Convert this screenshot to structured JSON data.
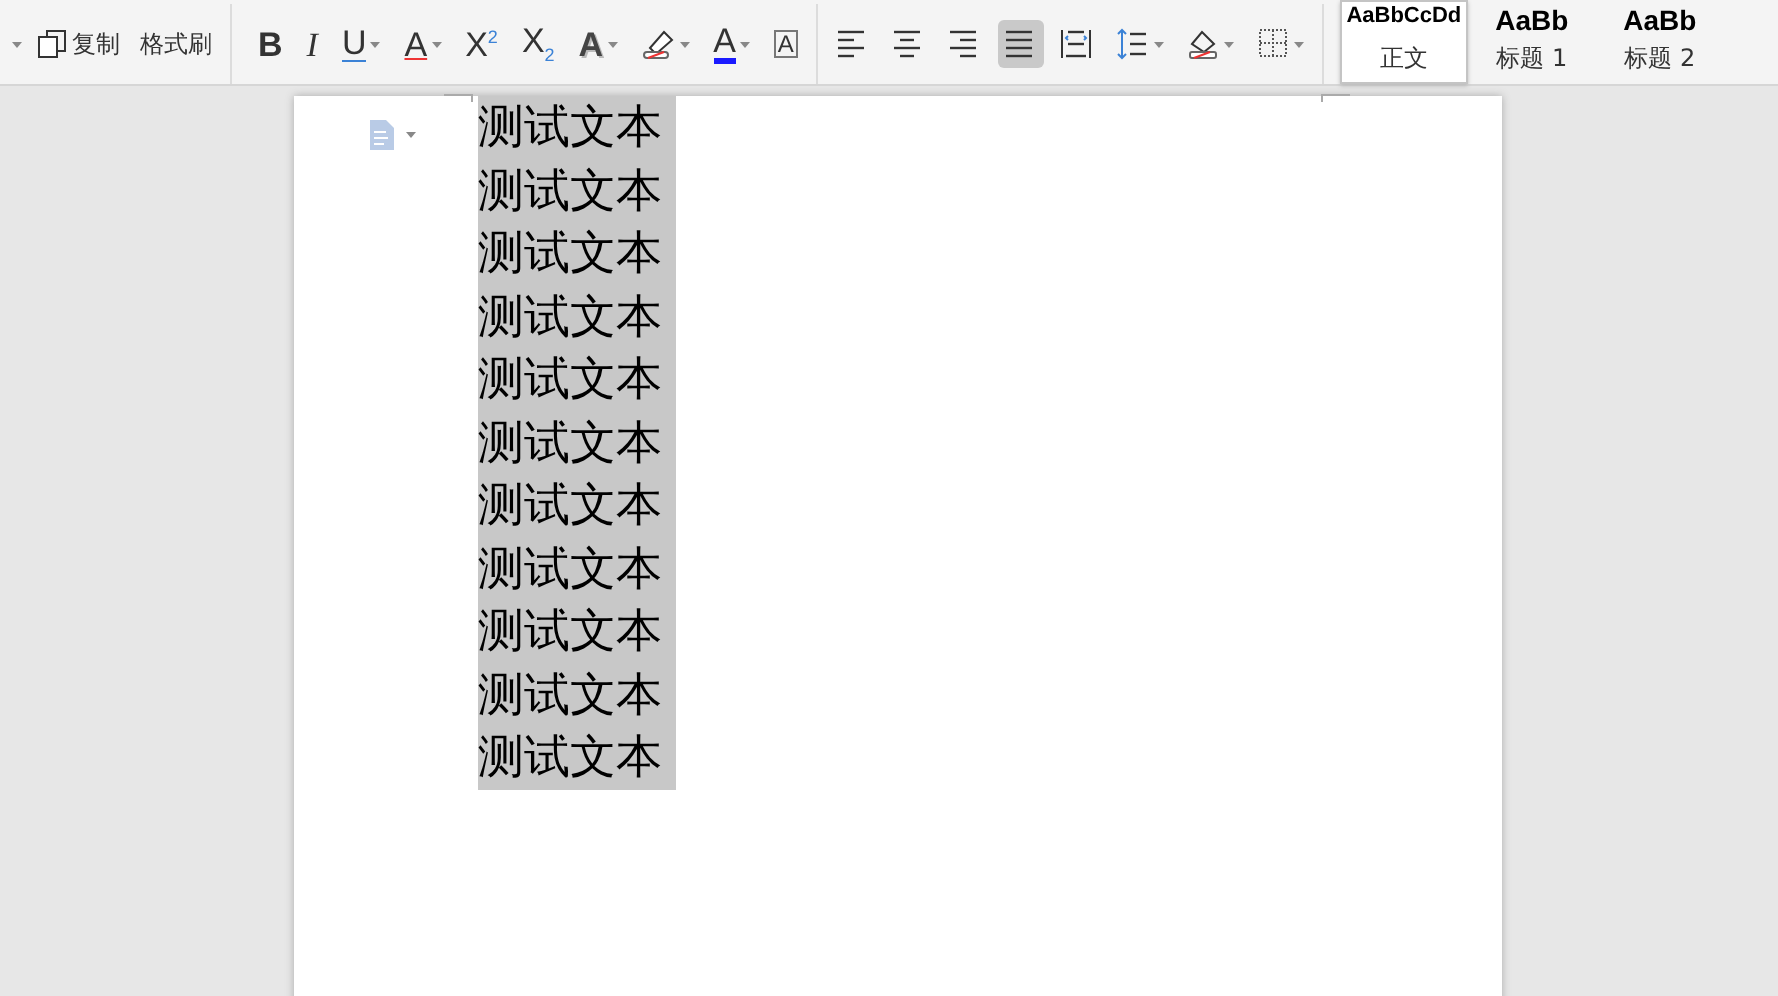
{
  "toolbar": {
    "clipboard": [
      {
        "kind": "copy",
        "label": "复制"
      },
      {
        "kind": "format-painter",
        "label": "格式刷"
      }
    ],
    "font_buttons": [
      {
        "kind": "bold",
        "glyph": "B",
        "dropdown": false
      },
      {
        "kind": "italic",
        "glyph": "I",
        "dropdown": false
      },
      {
        "kind": "underline",
        "glyph": "U",
        "dropdown": true
      },
      {
        "kind": "strike",
        "glyph": "A",
        "dropdown": true
      },
      {
        "kind": "superscript",
        "glyph": "X$^{2}$",
        "dropdown": false
      },
      {
        "kind": "subscript",
        "glyph": "X$_{2}$",
        "dropdown": false
      },
      {
        "kind": "effect",
        "glyph": "A",
        "dropdown": true
      },
      {
        "kind": "highlight",
        "dropdown": true
      },
      {
        "kind": "font-color",
        "glyph": "A",
        "dropdown": true
      },
      {
        "kind": "char-border",
        "glyph": "A",
        "dropdown": false
      }
    ],
    "paragraph_buttons": [
      {
        "kind": "align-left",
        "selected": false,
        "dropdown": false
      },
      {
        "kind": "align-center",
        "selected": false,
        "dropdown": false
      },
      {
        "kind": "align-right",
        "selected": false,
        "dropdown": false
      },
      {
        "kind": "justify",
        "selected": true,
        "dropdown": false
      },
      {
        "kind": "distribute",
        "selected": false,
        "dropdown": false
      },
      {
        "kind": "line-spacing",
        "selected": false,
        "dropdown": true
      },
      {
        "kind": "shading",
        "selected": false,
        "dropdown": true
      },
      {
        "kind": "borders",
        "selected": false,
        "dropdown": true
      }
    ],
    "styles": [
      {
        "preview": "AaBbCcDd",
        "label": "正文",
        "selected": true
      },
      {
        "preview": "AaBb",
        "label": "标题 1",
        "selected": false
      },
      {
        "preview": "AaBb",
        "label": "标题 2",
        "selected": false
      }
    ]
  },
  "document": {
    "lines": [
      {
        "text": "测试文本",
        "selected": true
      },
      {
        "text": "测试文本",
        "selected": true
      },
      {
        "text": "测试文本",
        "selected": true
      },
      {
        "text": "测试文本",
        "selected": true
      },
      {
        "text": "测试文本",
        "selected": true
      },
      {
        "text": "测试文本",
        "selected": true
      },
      {
        "text": "测试文本",
        "selected": true
      },
      {
        "text": "测试文本",
        "selected": true
      },
      {
        "text": "测试文本",
        "selected": true
      },
      {
        "text": "测试文本",
        "selected": true
      },
      {
        "text": "测试文本",
        "selected": true
      }
    ]
  }
}
